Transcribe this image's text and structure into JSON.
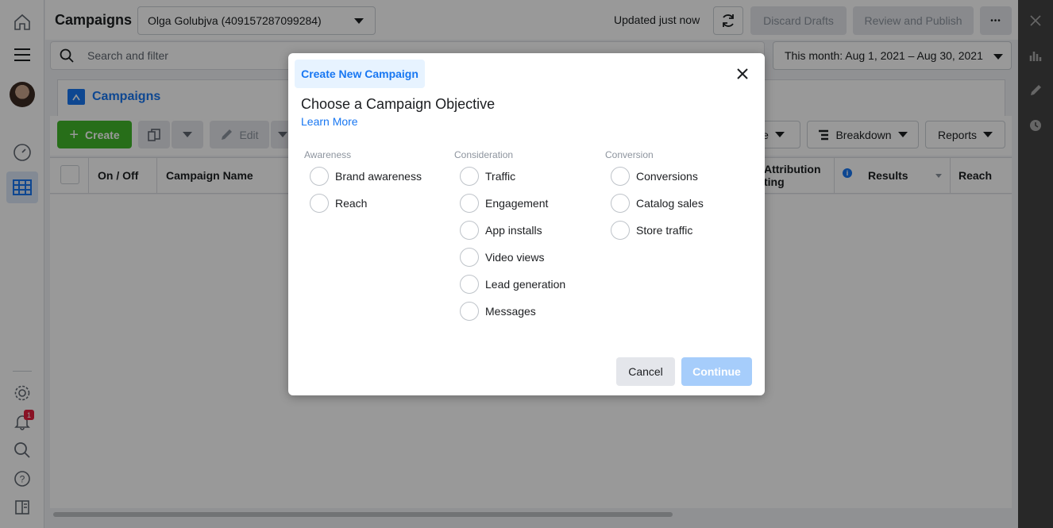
{
  "header": {
    "title": "Campaigns",
    "account": "Olga Golubjva (409157287099284)",
    "status": "Updated just now",
    "discard_label": "Discard Drafts",
    "review_label": "Review and Publish",
    "more_label": "•••"
  },
  "search": {
    "placeholder": "Search and filter",
    "date_range": "This month: Aug 1, 2021 – Aug 30, 2021"
  },
  "tabs": {
    "campaigns_label": "Campaigns"
  },
  "toolbar": {
    "create_label": "Create",
    "edit_label": "Edit",
    "columns_label_partial": "e",
    "breakdown_label": "Breakdown",
    "reports_label": "Reports"
  },
  "table": {
    "columns": [
      "On / Off",
      "Campaign Name",
      "Attribution\nting",
      "Results",
      "Reach"
    ]
  },
  "nav": {
    "notification_count": "1"
  },
  "modal": {
    "tab_label": "Create New Campaign",
    "title": "Choose a Campaign Objective",
    "learn_more": "Learn More",
    "columns": [
      {
        "heading": "Awareness",
        "options": [
          "Brand awareness",
          "Reach"
        ]
      },
      {
        "heading": "Consideration",
        "options": [
          "Traffic",
          "Engagement",
          "App installs",
          "Video views",
          "Lead generation",
          "Messages"
        ]
      },
      {
        "heading": "Conversion",
        "options": [
          "Conversions",
          "Catalog sales",
          "Store traffic"
        ]
      }
    ],
    "cancel_label": "Cancel",
    "continue_label": "Continue"
  },
  "colors": {
    "primary": "#1877f2",
    "create_green": "#42b72a",
    "continue_disabled": "#a6cdfb"
  }
}
